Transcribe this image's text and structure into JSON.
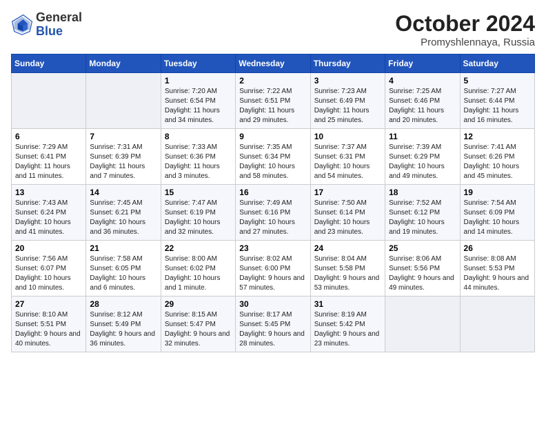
{
  "header": {
    "logo_general": "General",
    "logo_blue": "Blue",
    "month_title": "October 2024",
    "subtitle": "Promyshlennaya, Russia"
  },
  "weekdays": [
    "Sunday",
    "Monday",
    "Tuesday",
    "Wednesday",
    "Thursday",
    "Friday",
    "Saturday"
  ],
  "weeks": [
    [
      {
        "day": "",
        "sunrise": "",
        "sunset": "",
        "daylight": ""
      },
      {
        "day": "",
        "sunrise": "",
        "sunset": "",
        "daylight": ""
      },
      {
        "day": "1",
        "sunrise": "Sunrise: 7:20 AM",
        "sunset": "Sunset: 6:54 PM",
        "daylight": "Daylight: 11 hours and 34 minutes."
      },
      {
        "day": "2",
        "sunrise": "Sunrise: 7:22 AM",
        "sunset": "Sunset: 6:51 PM",
        "daylight": "Daylight: 11 hours and 29 minutes."
      },
      {
        "day": "3",
        "sunrise": "Sunrise: 7:23 AM",
        "sunset": "Sunset: 6:49 PM",
        "daylight": "Daylight: 11 hours and 25 minutes."
      },
      {
        "day": "4",
        "sunrise": "Sunrise: 7:25 AM",
        "sunset": "Sunset: 6:46 PM",
        "daylight": "Daylight: 11 hours and 20 minutes."
      },
      {
        "day": "5",
        "sunrise": "Sunrise: 7:27 AM",
        "sunset": "Sunset: 6:44 PM",
        "daylight": "Daylight: 11 hours and 16 minutes."
      }
    ],
    [
      {
        "day": "6",
        "sunrise": "Sunrise: 7:29 AM",
        "sunset": "Sunset: 6:41 PM",
        "daylight": "Daylight: 11 hours and 11 minutes."
      },
      {
        "day": "7",
        "sunrise": "Sunrise: 7:31 AM",
        "sunset": "Sunset: 6:39 PM",
        "daylight": "Daylight: 11 hours and 7 minutes."
      },
      {
        "day": "8",
        "sunrise": "Sunrise: 7:33 AM",
        "sunset": "Sunset: 6:36 PM",
        "daylight": "Daylight: 11 hours and 3 minutes."
      },
      {
        "day": "9",
        "sunrise": "Sunrise: 7:35 AM",
        "sunset": "Sunset: 6:34 PM",
        "daylight": "Daylight: 10 hours and 58 minutes."
      },
      {
        "day": "10",
        "sunrise": "Sunrise: 7:37 AM",
        "sunset": "Sunset: 6:31 PM",
        "daylight": "Daylight: 10 hours and 54 minutes."
      },
      {
        "day": "11",
        "sunrise": "Sunrise: 7:39 AM",
        "sunset": "Sunset: 6:29 PM",
        "daylight": "Daylight: 10 hours and 49 minutes."
      },
      {
        "day": "12",
        "sunrise": "Sunrise: 7:41 AM",
        "sunset": "Sunset: 6:26 PM",
        "daylight": "Daylight: 10 hours and 45 minutes."
      }
    ],
    [
      {
        "day": "13",
        "sunrise": "Sunrise: 7:43 AM",
        "sunset": "Sunset: 6:24 PM",
        "daylight": "Daylight: 10 hours and 41 minutes."
      },
      {
        "day": "14",
        "sunrise": "Sunrise: 7:45 AM",
        "sunset": "Sunset: 6:21 PM",
        "daylight": "Daylight: 10 hours and 36 minutes."
      },
      {
        "day": "15",
        "sunrise": "Sunrise: 7:47 AM",
        "sunset": "Sunset: 6:19 PM",
        "daylight": "Daylight: 10 hours and 32 minutes."
      },
      {
        "day": "16",
        "sunrise": "Sunrise: 7:49 AM",
        "sunset": "Sunset: 6:16 PM",
        "daylight": "Daylight: 10 hours and 27 minutes."
      },
      {
        "day": "17",
        "sunrise": "Sunrise: 7:50 AM",
        "sunset": "Sunset: 6:14 PM",
        "daylight": "Daylight: 10 hours and 23 minutes."
      },
      {
        "day": "18",
        "sunrise": "Sunrise: 7:52 AM",
        "sunset": "Sunset: 6:12 PM",
        "daylight": "Daylight: 10 hours and 19 minutes."
      },
      {
        "day": "19",
        "sunrise": "Sunrise: 7:54 AM",
        "sunset": "Sunset: 6:09 PM",
        "daylight": "Daylight: 10 hours and 14 minutes."
      }
    ],
    [
      {
        "day": "20",
        "sunrise": "Sunrise: 7:56 AM",
        "sunset": "Sunset: 6:07 PM",
        "daylight": "Daylight: 10 hours and 10 minutes."
      },
      {
        "day": "21",
        "sunrise": "Sunrise: 7:58 AM",
        "sunset": "Sunset: 6:05 PM",
        "daylight": "Daylight: 10 hours and 6 minutes."
      },
      {
        "day": "22",
        "sunrise": "Sunrise: 8:00 AM",
        "sunset": "Sunset: 6:02 PM",
        "daylight": "Daylight: 10 hours and 1 minute."
      },
      {
        "day": "23",
        "sunrise": "Sunrise: 8:02 AM",
        "sunset": "Sunset: 6:00 PM",
        "daylight": "Daylight: 9 hours and 57 minutes."
      },
      {
        "day": "24",
        "sunrise": "Sunrise: 8:04 AM",
        "sunset": "Sunset: 5:58 PM",
        "daylight": "Daylight: 9 hours and 53 minutes."
      },
      {
        "day": "25",
        "sunrise": "Sunrise: 8:06 AM",
        "sunset": "Sunset: 5:56 PM",
        "daylight": "Daylight: 9 hours and 49 minutes."
      },
      {
        "day": "26",
        "sunrise": "Sunrise: 8:08 AM",
        "sunset": "Sunset: 5:53 PM",
        "daylight": "Daylight: 9 hours and 44 minutes."
      }
    ],
    [
      {
        "day": "27",
        "sunrise": "Sunrise: 8:10 AM",
        "sunset": "Sunset: 5:51 PM",
        "daylight": "Daylight: 9 hours and 40 minutes."
      },
      {
        "day": "28",
        "sunrise": "Sunrise: 8:12 AM",
        "sunset": "Sunset: 5:49 PM",
        "daylight": "Daylight: 9 hours and 36 minutes."
      },
      {
        "day": "29",
        "sunrise": "Sunrise: 8:15 AM",
        "sunset": "Sunset: 5:47 PM",
        "daylight": "Daylight: 9 hours and 32 minutes."
      },
      {
        "day": "30",
        "sunrise": "Sunrise: 8:17 AM",
        "sunset": "Sunset: 5:45 PM",
        "daylight": "Daylight: 9 hours and 28 minutes."
      },
      {
        "day": "31",
        "sunrise": "Sunrise: 8:19 AM",
        "sunset": "Sunset: 5:42 PM",
        "daylight": "Daylight: 9 hours and 23 minutes."
      },
      {
        "day": "",
        "sunrise": "",
        "sunset": "",
        "daylight": ""
      },
      {
        "day": "",
        "sunrise": "",
        "sunset": "",
        "daylight": ""
      }
    ]
  ]
}
